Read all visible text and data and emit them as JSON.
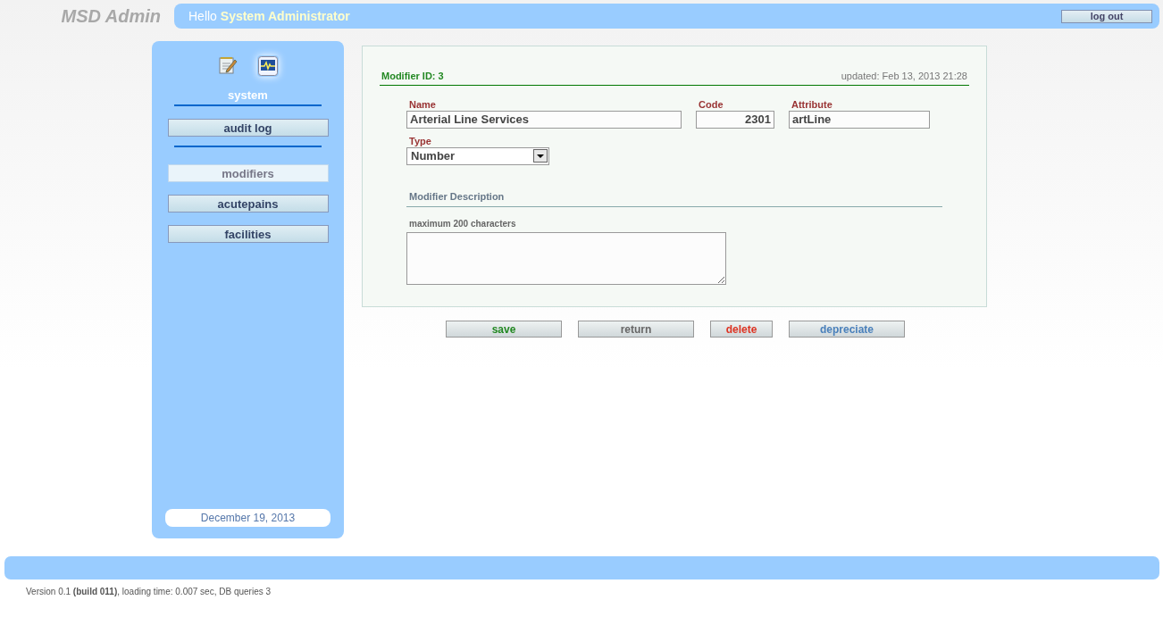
{
  "header": {
    "app_title": "MSD Admin",
    "greeting": "Hello **System Administrator**",
    "logout": "log out"
  },
  "sidebar": {
    "icons": [
      {
        "kind": "notepad",
        "selected": false
      },
      {
        "kind": "monitor",
        "selected": true
      }
    ],
    "section": "system",
    "nav_groups": [
      {
        "items": [
          {
            "label": "audit log",
            "selected": false
          }
        ]
      },
      {
        "items": [
          {
            "label": "modifiers",
            "selected": true
          },
          {
            "label": "acutepains",
            "selected": false
          },
          {
            "label": "facilities",
            "selected": false
          }
        ]
      }
    ],
    "date": "December 19, 2013"
  },
  "form": {
    "heading": "Modifier ID: 3",
    "updated": "updated: Feb 13, 2013 21:28",
    "name": {
      "label": "Name",
      "value": "Arterial Line Services"
    },
    "code": {
      "label": "Code",
      "value": "2301"
    },
    "attribute": {
      "label": "Attribute",
      "value": "artLine"
    },
    "type": {
      "label": "Type",
      "value": "Number"
    },
    "description": {
      "heading": "Modifier Description",
      "hint": "maximum 200 characters"
    }
  },
  "buttons": [
    {
      "label": "save",
      "kind": "save"
    },
    {
      "label": "return",
      "kind": "neutral"
    },
    {
      "label": "delete",
      "kind": "danger"
    },
    {
      "label": "depreciate",
      "kind": "info"
    }
  ],
  "footer": {
    "version": "Version 0.1 **(build 011)**, loading time: 0.007 sec, DB queries 3"
  }
}
